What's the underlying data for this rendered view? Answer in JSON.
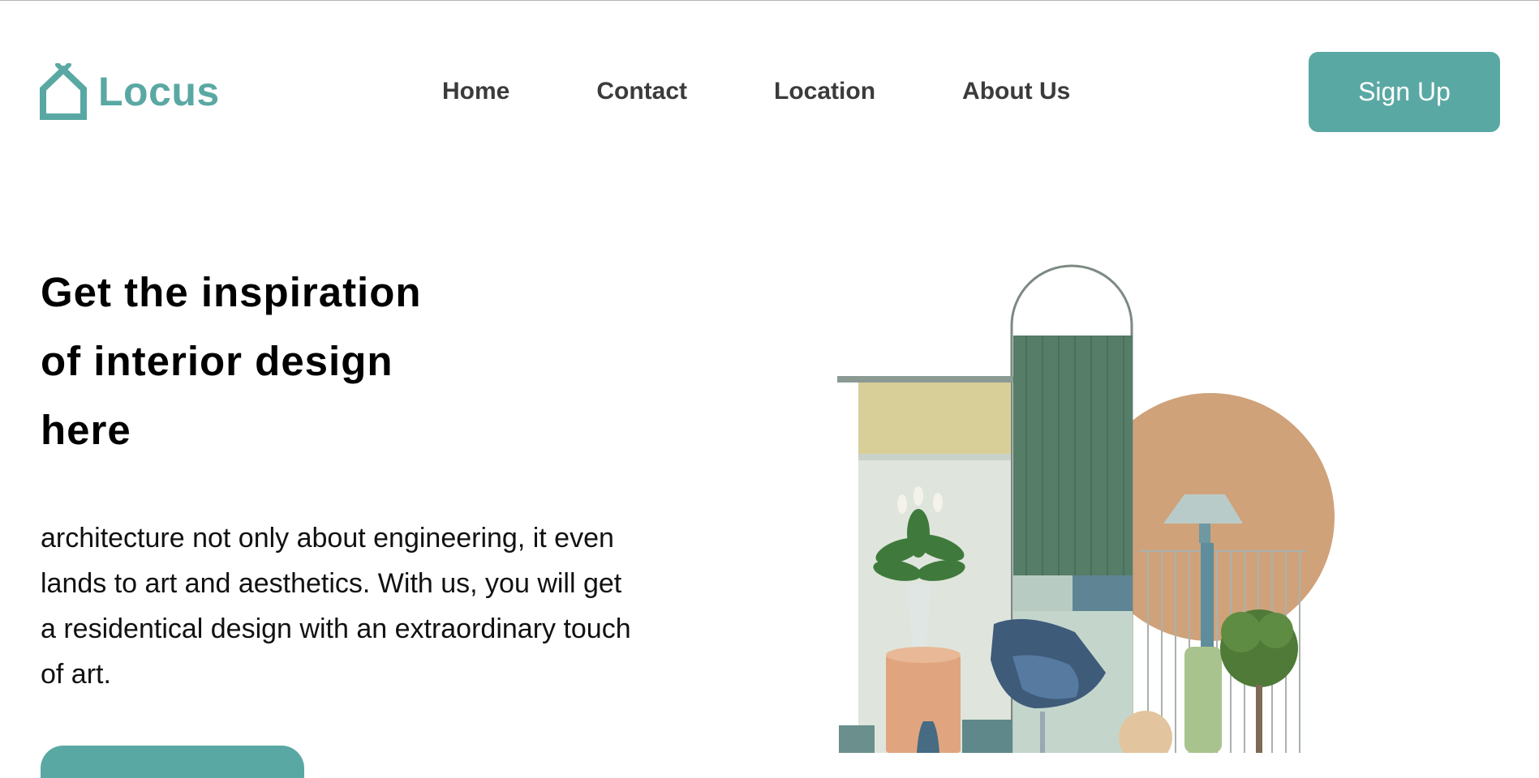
{
  "header": {
    "logo_text": "Locus",
    "nav": [
      "Home",
      "Contact",
      "Location",
      "About Us"
    ],
    "signup_label": "Sign Up"
  },
  "hero": {
    "headline_lines": [
      "Get the inspiration",
      "of interior design",
      "here"
    ],
    "description_lines": [
      "architecture not only about engineering, it even",
      "lands to art and aesthetics. With us, you will get",
      "a residentical design with an extraordinary touch",
      "of art."
    ]
  },
  "colors": {
    "accent": "#5aa8a3",
    "nav_text": "#3b3b3b"
  }
}
